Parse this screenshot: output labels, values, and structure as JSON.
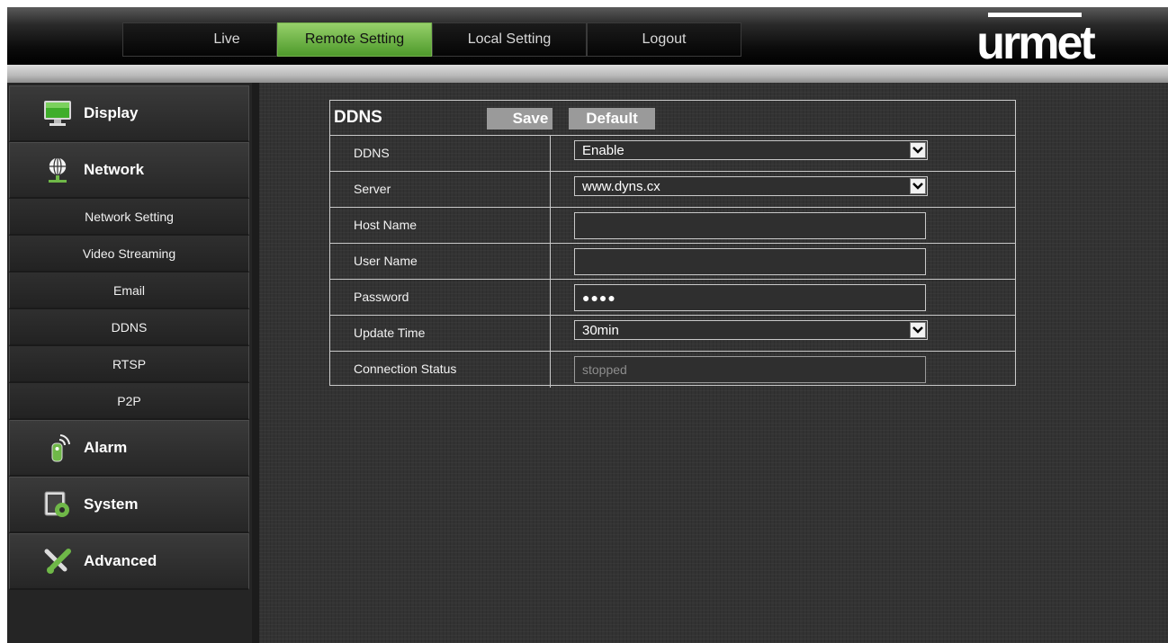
{
  "nav": {
    "tabs": [
      {
        "label": "Live",
        "active": false
      },
      {
        "label": "Remote Setting",
        "active": true
      },
      {
        "label": "Local Setting",
        "active": false
      },
      {
        "label": "Logout",
        "active": false
      }
    ],
    "logo_text": "urmet"
  },
  "sidebar": {
    "display": "Display",
    "network": "Network",
    "network_sub": [
      "Network Setting",
      "Video Streaming",
      "Email",
      "DDNS",
      "RTSP",
      "P2P"
    ],
    "alarm": "Alarm",
    "system": "System",
    "advanced": "Advanced"
  },
  "panel": {
    "title": "DDNS",
    "save_label": "Save",
    "default_label": "Default",
    "rows": {
      "ddns": {
        "label": "DDNS",
        "value": "Enable"
      },
      "server": {
        "label": "Server",
        "value": "www.dyns.cx"
      },
      "host_name": {
        "label": "Host Name",
        "value": ""
      },
      "user_name": {
        "label": "User Name",
        "value": ""
      },
      "password": {
        "label": "Password",
        "value": "●●●●"
      },
      "update_time": {
        "label": "Update Time",
        "value": "30min"
      },
      "connection_status": {
        "label": "Connection Status",
        "value": "stopped"
      }
    }
  },
  "colors": {
    "accent_green": "#6fb848",
    "button_gray": "#9a9a9a"
  }
}
